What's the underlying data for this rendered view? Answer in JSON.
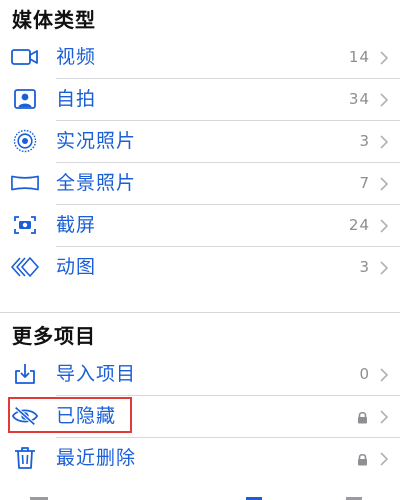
{
  "sections": {
    "media_types": {
      "title": "媒体类型"
    },
    "more_items": {
      "title": "更多项目"
    }
  },
  "media_items": [
    {
      "icon": "video-icon",
      "label": "视频",
      "count": "14"
    },
    {
      "icon": "selfie-portrait-icon",
      "label": "自拍",
      "count": "34"
    },
    {
      "icon": "live-photo-icon",
      "label": "实况照片",
      "count": "3"
    },
    {
      "icon": "panorama-icon",
      "label": "全景照片",
      "count": "7"
    },
    {
      "icon": "screenshot-icon",
      "label": "截屏",
      "count": "24"
    },
    {
      "icon": "animated-icon",
      "label": "动图",
      "count": "3"
    }
  ],
  "more_items": [
    {
      "icon": "import-icon",
      "label": "导入项目",
      "count": "0"
    },
    {
      "icon": "hidden-eye-slash-icon",
      "label": "已隐藏",
      "locked": true
    },
    {
      "icon": "trash-icon",
      "label": "最近删除",
      "locked": true
    }
  ],
  "colors": {
    "accent": "#1a5fd8",
    "highlight": "#e03a3a",
    "secondary_text": "#8e8e93"
  }
}
